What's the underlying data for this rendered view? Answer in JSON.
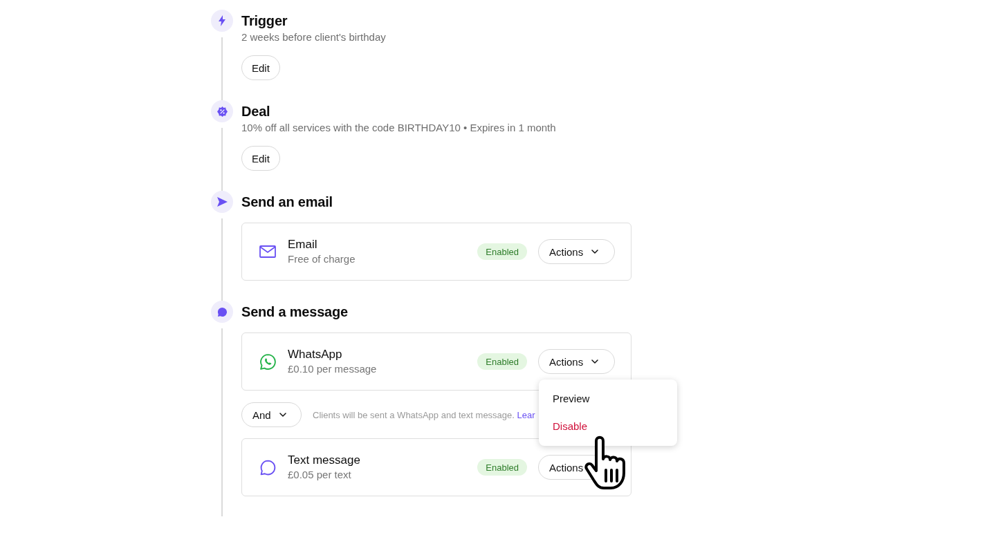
{
  "steps": [
    {
      "kind": "trigger",
      "title": "Trigger",
      "description": "2 weeks before client's birthday",
      "edit_label": "Edit"
    },
    {
      "kind": "deal",
      "title": "Deal",
      "description": "10% off all services with the code BIRTHDAY10 • Expires in 1 month",
      "edit_label": "Edit"
    },
    {
      "kind": "email",
      "title": "Send an email",
      "items": [
        {
          "kind": "email",
          "name": "Email",
          "price": "Free of charge",
          "status": "Enabled",
          "actions_label": "Actions",
          "caret": true
        }
      ]
    },
    {
      "kind": "message",
      "title": "Send a message",
      "items": [
        {
          "kind": "whatsapp",
          "name": "WhatsApp",
          "price": "£0.10 per message",
          "status": "Enabled",
          "actions_label": "Actions",
          "caret": true,
          "menu": [
            {
              "label": "Preview",
              "kind": "normal"
            },
            {
              "label": "Disable",
              "kind": "danger"
            }
          ]
        },
        {
          "kind": "joiner",
          "label": "And",
          "note": "Clients will be sent a WhatsApp and text message.",
          "link": "Lear"
        },
        {
          "kind": "sms",
          "name": "Text message",
          "price": "£0.05 per text",
          "status": "Enabled",
          "actions_label": "Actions"
        }
      ]
    }
  ]
}
